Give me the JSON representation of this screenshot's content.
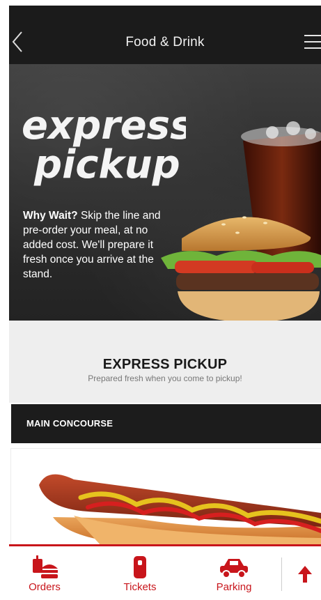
{
  "header": {
    "title": "Food & Drink"
  },
  "hero": {
    "logo_line1": "express",
    "logo_line2": "pickup",
    "lead": "Why Wait?",
    "copy": " Skip the line and pre-order your meal, at no added cost. We'll prepare it fresh once you arrive at the stand."
  },
  "band": {
    "heading": "EXPRESS PICKUP",
    "subheading": "Prepared fresh when you come to pickup!"
  },
  "concourse": {
    "label": "MAIN CONCOURSE"
  },
  "tabs": [
    {
      "label": "Orders",
      "icon": "orders-icon"
    },
    {
      "label": "Tickets",
      "icon": "ticket-icon"
    },
    {
      "label": "Parking",
      "icon": "car-icon"
    }
  ],
  "colors": {
    "accent": "#c8151b",
    "header_bg": "#1b1b1b",
    "band_bg": "#eeeeee"
  }
}
